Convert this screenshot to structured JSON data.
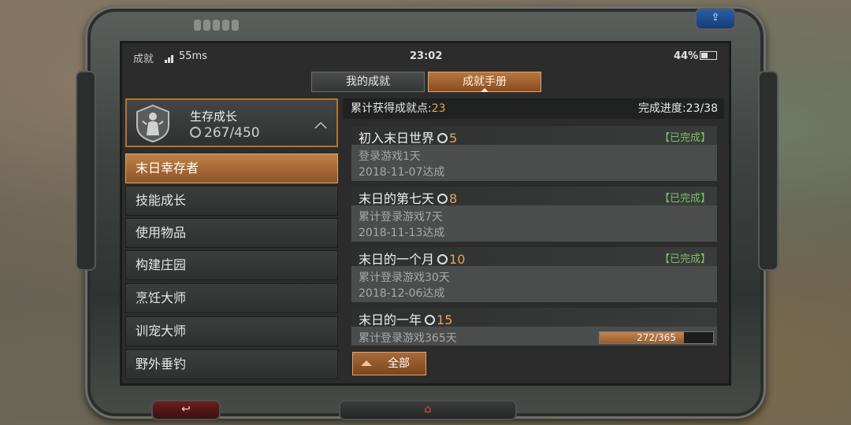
{
  "status_bar": {
    "app_name": "成就",
    "ping": "55ms",
    "time": "23:02",
    "battery": "44%",
    "battery_level": 0.44
  },
  "tabs": [
    {
      "label": "我的成就"
    },
    {
      "label": "成就手册"
    }
  ],
  "active_tab": "成就手册",
  "category": {
    "title": "生存成长",
    "points": "267/450"
  },
  "subcategories": [
    {
      "label": "末日幸存者",
      "active": true
    },
    {
      "label": "技能成长"
    },
    {
      "label": "使用物品"
    },
    {
      "label": "构建庄园"
    },
    {
      "label": "烹饪大师"
    },
    {
      "label": "训宠大师"
    },
    {
      "label": "野外垂钓"
    }
  ],
  "summary": {
    "points_label": "累计获得成就点:",
    "points_value": "23",
    "progress": "完成进度:23/38"
  },
  "achievements": [
    {
      "name": "初入末日世界",
      "points": "5",
      "status": "【已完成】",
      "desc": "登录游戏1天",
      "date": "2018-11-07达成"
    },
    {
      "name": "末日的第七天",
      "points": "8",
      "status": "【已完成】",
      "desc": "累计登录游戏7天",
      "date": "2018-11-13达成"
    },
    {
      "name": "末日的一个月",
      "points": "10",
      "status": "【已完成】",
      "desc": "累计登录游戏30天",
      "date": "2018-12-06达成"
    },
    {
      "name": "末日的一年",
      "points": "15",
      "desc": "累计登录游戏365天",
      "progress_text": "272/365",
      "progress_value": 0.745
    }
  ],
  "filter_button": "全部",
  "icons": [
    "back-icon",
    "home-icon",
    "share-icon",
    "survivor-badge-icon",
    "medal-icon"
  ],
  "colors": {
    "accent_orange": "#e9a35c",
    "completed_green": "#78c06a",
    "active_tab": "#b7763e"
  }
}
